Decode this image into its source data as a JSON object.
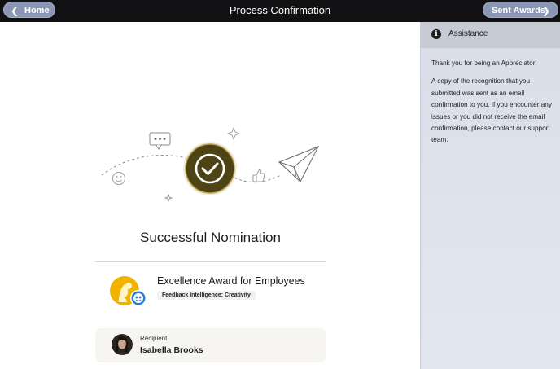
{
  "header": {
    "title": "Process Confirmation",
    "home_label": "Home",
    "sent_awards_label": "Sent Awards"
  },
  "sidebar": {
    "title": "Assistance",
    "paragraphs": [
      "Thank you for being an Appreciator!",
      "A copy of the recognition that you submitted was sent as an email confirmation to you. If you encounter any issues or you did not receive the email confirmation, please contact our support team."
    ]
  },
  "main": {
    "headline": "Successful Nomination",
    "award": {
      "title": "Excellence Award for Employees",
      "tag": "Feedback Intelligence: Creativity"
    },
    "recipient": {
      "label": "Recipient",
      "name": "Isabella Brooks"
    }
  },
  "colors": {
    "topbar": "#111114",
    "pill": "#8a96b4",
    "check_badge": "#4e4314",
    "award_gold": "#f0b400",
    "sidebar_bg": "#dfe3ec"
  }
}
